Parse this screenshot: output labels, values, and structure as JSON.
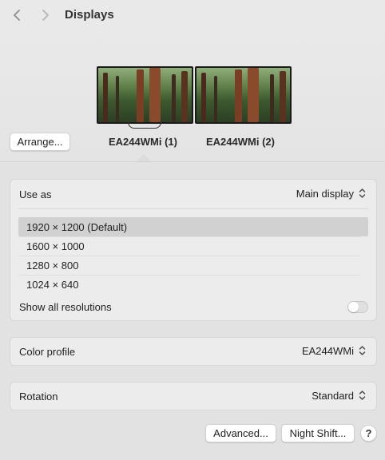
{
  "header": {
    "title": "Displays",
    "back_icon": "chevron-left-icon",
    "forward_icon": "chevron-right-icon"
  },
  "arrangement": {
    "arrange_label": "Arrange...",
    "monitors": [
      {
        "label": "EA244WMi (1)",
        "selected": true
      },
      {
        "label": "EA244WMi (2)",
        "selected": false
      }
    ]
  },
  "use_as": {
    "label": "Use as",
    "value": "Main display"
  },
  "resolutions": {
    "items": [
      {
        "label": "1920 × 1200 (Default)",
        "selected": true
      },
      {
        "label": "1600 × 1000",
        "selected": false
      },
      {
        "label": "1280 × 800",
        "selected": false
      },
      {
        "label": "1024 × 640",
        "selected": false
      }
    ],
    "show_all_label": "Show all resolutions",
    "show_all_on": false
  },
  "color_profile": {
    "label": "Color profile",
    "value": "EA244WMi"
  },
  "rotation": {
    "label": "Rotation",
    "value": "Standard"
  },
  "footer": {
    "advanced_label": "Advanced...",
    "night_shift_label": "Night Shift...",
    "help_label": "?"
  },
  "colors": {
    "window_bg": "#e9e9e9",
    "panel_bg": "#ececec",
    "selected_row": "#d1d1d1"
  }
}
